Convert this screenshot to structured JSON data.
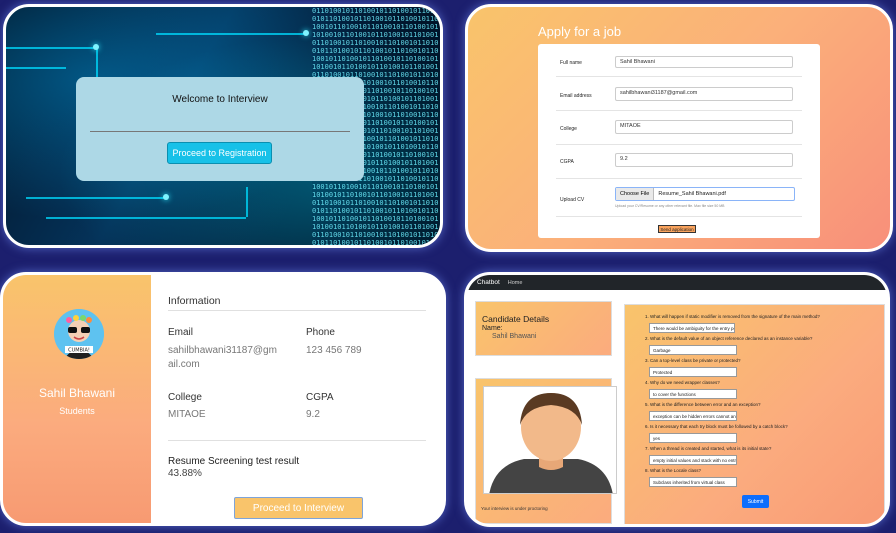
{
  "welcome": {
    "title": "Welcome to Interview",
    "button": "Proceed to Registration",
    "binary_text": "01101001011010010110100101101001011010010110100101101001011010010110100101101001011010010110100101101001011010010110100101101001011010010110100101101001011010010110100101101001011010010110100101101001011010010110100101101001011010010110100101101001011010010110100101101001011010010110100101101001011010010110100101101001011010010110100101101001011010010110100101101001011010010110100101101001011010010110100101101001011010010110100101101001011010010110100101101001011010010110100101101001011010010110100101101001011010010110100101101001011010010110100101101001011010010110100101101001011010010110100101101001011010010110100101101001011010010110100101101001011010010110100101101001011010010110100101101001011010010110100101101001011010010110100101101001011010010110100101101001011010010110100101101001011010010110100101101001011010010110100101101001011010010110100101101001011010010110100101101001011010010110100101101001011010010110100101101001011010010110100101101001011010010110100101101001011010010110100101101001011010010110100101101001011010010110100101101001011010010110100101101001"
  },
  "apply": {
    "title": "Apply for a job",
    "fields": {
      "fullname": {
        "label": "Full name",
        "value": "Sahil Bhawani"
      },
      "email": {
        "label": "Email address",
        "value": "sahilbhawani31187@gmail.com"
      },
      "college": {
        "label": "College",
        "value": "MITAOE"
      },
      "cgpa": {
        "label": "CGPA",
        "value": "9.2"
      },
      "cv": {
        "label": "Upload CV",
        "button": "Choose File",
        "filename": "Resume_Sahil Bhawani.pdf",
        "help": "Upload your CV/Resume or any other relevant file. Max file size 50 MB"
      }
    },
    "submit": "Send application"
  },
  "profile": {
    "avatar_text": "CUMBIA!",
    "name": "Sahil Bhawani",
    "role": "Students",
    "info_heading": "Information",
    "email_label": "Email",
    "email_value": "sahilbhawani31187@gm",
    "email_value_2": "ail.com",
    "phone_label": "Phone",
    "phone_value": "123 456 789",
    "college_label": "College",
    "college_value": "MITAOE",
    "cgpa_label": "CGPA",
    "cgpa_value": "9.2",
    "resume_label": "Resume Screening test result",
    "resume_value": "43.88%",
    "button": "Proceed to Interview"
  },
  "chatbot": {
    "brand": "Chatbot",
    "nav_home": "Home",
    "candidate_title": "Candidate Details",
    "name_label": "Name:",
    "name_value": "Sahil Bhawani",
    "proctor_text": "Your interview is under proctoring",
    "questions": [
      {
        "q": "1. What will happen if static modifier is removed from the signature of the main method?",
        "a": "There would be ambiguity for the entry poi"
      },
      {
        "q": "2. What is the default value of an object reference declared as an instance variable?",
        "a": "Garbage"
      },
      {
        "q": "3. Can a top-level class be private or protected?",
        "a": "Protected"
      },
      {
        "q": "4. Why do we need wrapper classes?",
        "a": "to cover the functions"
      },
      {
        "q": "5. What is the difference between error and an exception?",
        "a": "exception can be hidden errors cannot and"
      },
      {
        "q": "6. Is it necessary that each try block must be followed by a catch block?",
        "a": "yes"
      },
      {
        "q": "7. When a thread is created and started, what is its initial state?",
        "a": "empty initial values and stack with no entry"
      },
      {
        "q": "8. What is the Locale class?",
        "a": "Subclass inherited from virtual class"
      }
    ],
    "submit": "Submit"
  }
}
